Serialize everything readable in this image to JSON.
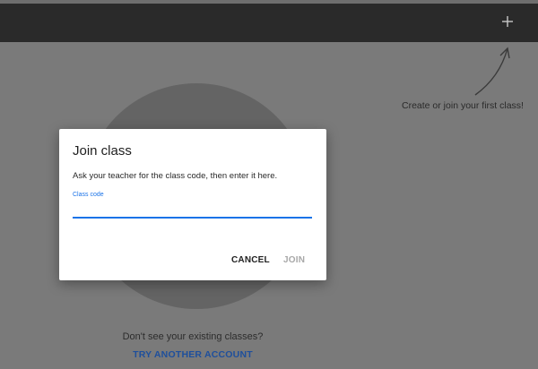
{
  "header": {
    "add_icon": "plus-icon"
  },
  "hint": {
    "text": "Create or join your first class!"
  },
  "dialog": {
    "title": "Join class",
    "description": "Ask your teacher for the class code, then enter it here.",
    "field_label": "Class code",
    "field_value": "",
    "cancel_label": "CANCEL",
    "join_label": "JOIN"
  },
  "footer": {
    "question": "Don't see your existing classes?",
    "link_label": "TRY ANOTHER ACCOUNT"
  }
}
